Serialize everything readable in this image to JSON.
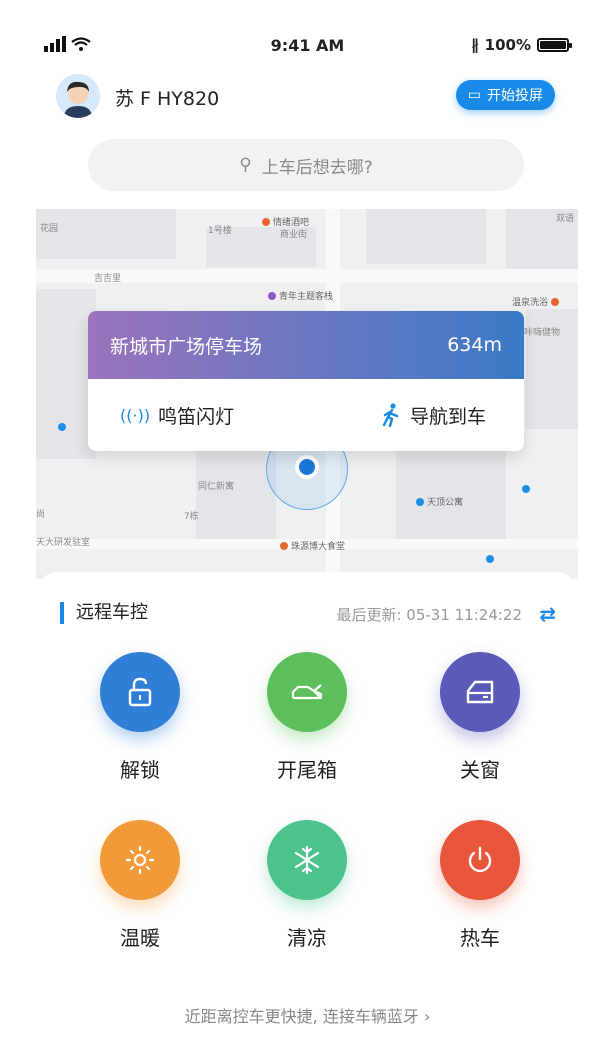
{
  "status_bar": {
    "time": "9:41 AM",
    "battery": "100%",
    "battery_level": 1.0
  },
  "header": {
    "plate": "苏 F HY820",
    "cast_label": "开始投屏"
  },
  "search": {
    "placeholder": "上车后想去哪?"
  },
  "map": {
    "labels": [
      "花园",
      "1号楼",
      "情绪酒吧",
      "商业街",
      "双语",
      "吉吉里",
      "青年主题客栈",
      "温泉洗浴",
      "咔嗨健物",
      "同仁新寓",
      "7栋",
      "尚",
      "天大研发驻室",
      "珠源博大食堂",
      "天顶公寓"
    ],
    "popup": {
      "title": "新城市广场停车场",
      "distance": "634m",
      "horn_label": "鸣笛闪灯",
      "navigate_label": "导航到车"
    }
  },
  "panel": {
    "title": "远程车控",
    "last_update": "最后更新: 05-31 11:24:22",
    "controls": [
      {
        "label": "解锁",
        "icon": "unlock-icon",
        "color": "#2f7fd8"
      },
      {
        "label": "开尾箱",
        "icon": "trunk-icon",
        "color": "#5cbf5c"
      },
      {
        "label": "关窗",
        "icon": "window-icon",
        "color": "#5a5ab8"
      },
      {
        "label": "温暖",
        "icon": "sun-icon",
        "color": "#f09a3a"
      },
      {
        "label": "清凉",
        "icon": "snowflake-icon",
        "color": "#4cc38c"
      },
      {
        "label": "热车",
        "icon": "power-icon",
        "color": "#e8563c"
      }
    ]
  },
  "footer": {
    "bluetooth_hint": "近距离控车更快捷, 连接车辆蓝牙 ›"
  }
}
